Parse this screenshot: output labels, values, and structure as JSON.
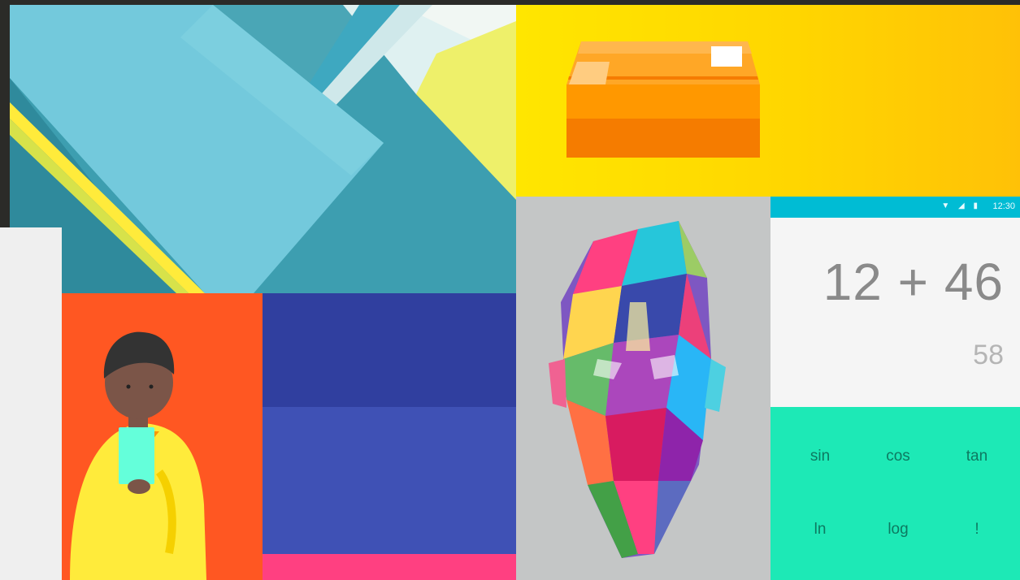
{
  "calculator": {
    "status_time": "12:30",
    "status_icons": "▼ ◢ ▮",
    "formula": "12 + 46",
    "result": "58",
    "keys": [
      "sin",
      "cos",
      "tan",
      "ln",
      "log",
      "!"
    ]
  },
  "colors": {
    "orange": "#ff5722",
    "indigo_dark": "#303f9f",
    "indigo": "#3f51b5",
    "pink": "#ff4081",
    "teal_status": "#00bcd4",
    "mint_pad": "#1de9b6",
    "yellow": "#ffd600"
  },
  "images": [
    "material-geometric-shapes",
    "package-box",
    "person-with-phone",
    "low-poly-head"
  ]
}
